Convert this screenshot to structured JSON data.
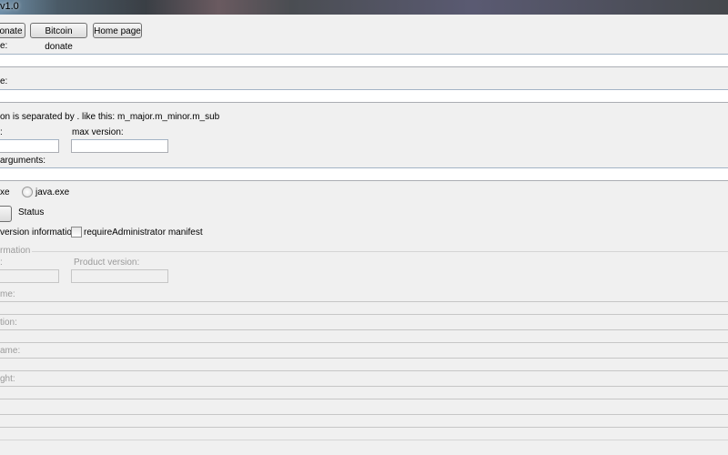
{
  "window": {
    "title": "v1.0"
  },
  "toolbar": {
    "donate": "onate",
    "bitcoin": "Bitcoin donate",
    "home": "Home page"
  },
  "fields": {
    "label1": "e:",
    "label2": "e:",
    "version_note": "on is separated by . like this: m_major.m_minor.m_sub",
    "min_label": ":",
    "max_label": "max version:",
    "args_label": "arguments:"
  },
  "runtime": {
    "option1": "xe",
    "option2": "java.exe"
  },
  "status": {
    "label": "Status"
  },
  "options": {
    "version_info": "version information",
    "require_admin": "requireAdministrator manifest"
  },
  "version_info": {
    "group": "rmation",
    "file_version_label": ":",
    "product_version_label": "Product version:",
    "name_label": "me:",
    "description_label": "tion:",
    "company_label": "ame:",
    "copyright_label": "ght:"
  }
}
